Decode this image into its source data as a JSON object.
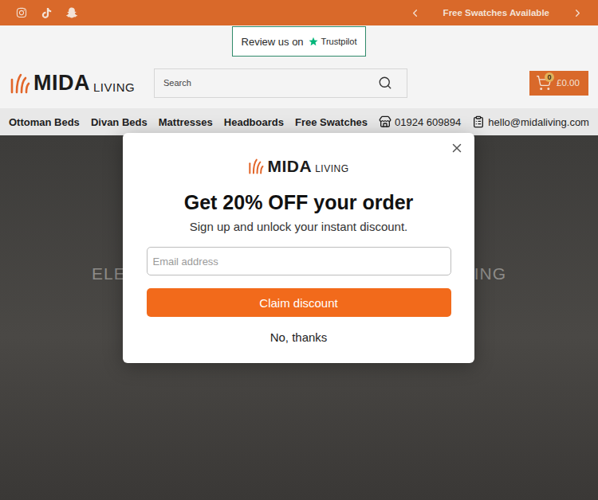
{
  "announcement": {
    "text": "Free Swatches Available"
  },
  "trustpilot": {
    "label": "Review us on",
    "brand": "Trustpilot"
  },
  "header_logo": {
    "name": "MIDA",
    "suffix": "LIVING"
  },
  "search": {
    "placeholder": "Search"
  },
  "cart": {
    "count": "0",
    "total": "£0.00"
  },
  "nav": [
    {
      "label": "Ottoman Beds"
    },
    {
      "label": "Divan Beds"
    },
    {
      "label": "Mattresses"
    },
    {
      "label": "Headboards"
    },
    {
      "label": "Free Swatches"
    }
  ],
  "contact": {
    "phone": "01924 609894",
    "email": "hello@midaliving.com"
  },
  "hero": {
    "title_start": "ELEV",
    "title_end": "ING"
  },
  "popup": {
    "logo": {
      "name": "MIDA",
      "suffix": "LIVING"
    },
    "title": "Get 20% OFF your order",
    "subtitle": "Sign up and unlock your instant discount.",
    "email_placeholder": "Email address",
    "button": "Claim discount",
    "dismiss": "No, thanks"
  }
}
